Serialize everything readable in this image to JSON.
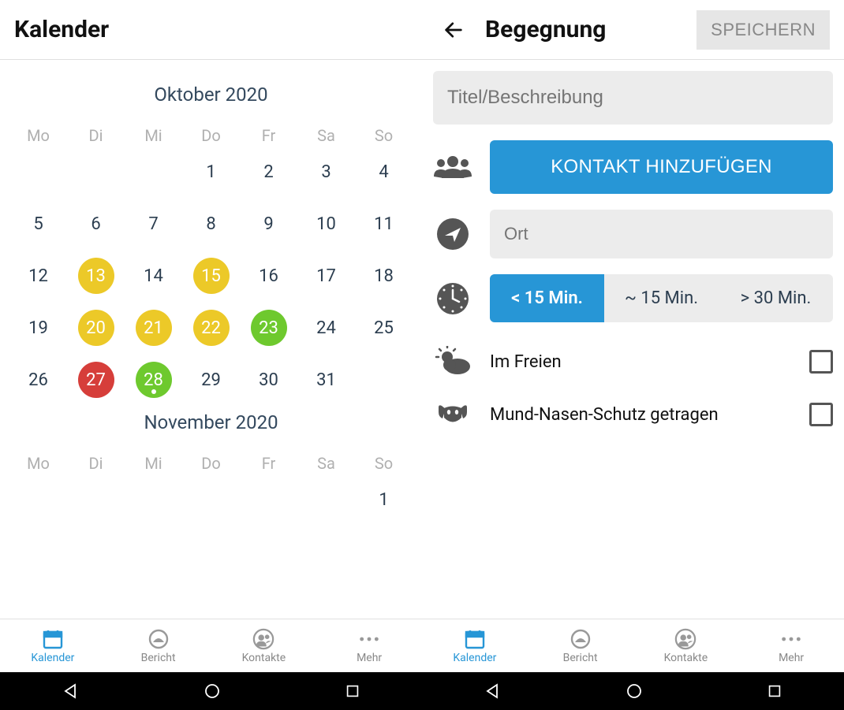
{
  "left": {
    "title": "Kalender",
    "months": [
      {
        "name": "Oktober 2020",
        "weekdays": [
          "Mo",
          "Di",
          "Mi",
          "Do",
          "Fr",
          "Sa",
          "So"
        ],
        "weeks": [
          [
            null,
            null,
            {
              "d": 1
            },
            {
              "d": 2
            },
            {
              "d": 3
            },
            {
              "d": 4
            },
            null
          ],
          [
            null,
            null,
            null,
            {
              "d": 1
            },
            {
              "d": 2
            },
            {
              "d": 3
            },
            {
              "d": 4
            }
          ],
          [
            {
              "d": 5
            },
            {
              "d": 6
            },
            {
              "d": 7
            },
            {
              "d": 8
            },
            {
              "d": 9
            },
            {
              "d": 10
            },
            {
              "d": 11
            }
          ],
          [
            {
              "d": 12
            },
            {
              "d": 13,
              "c": "yellow"
            },
            {
              "d": 14
            },
            {
              "d": 15,
              "c": "yellow"
            },
            {
              "d": 16
            },
            {
              "d": 17
            },
            {
              "d": 18
            }
          ],
          [
            {
              "d": 19
            },
            {
              "d": 20,
              "c": "yellow"
            },
            {
              "d": 21,
              "c": "yellow"
            },
            {
              "d": 22,
              "c": "yellow"
            },
            {
              "d": 23,
              "c": "green"
            },
            {
              "d": 24
            },
            {
              "d": 25
            }
          ],
          [
            {
              "d": 26
            },
            {
              "d": 27,
              "c": "red"
            },
            {
              "d": 28,
              "c": "green",
              "dot": true
            },
            {
              "d": 29
            },
            {
              "d": 30
            },
            {
              "d": 31
            },
            null
          ]
        ]
      },
      {
        "name": "November 2020",
        "weekdays": [
          "Mo",
          "Di",
          "Mi",
          "Do",
          "Fr",
          "Sa",
          "So"
        ],
        "weeks": [
          [
            null,
            null,
            null,
            null,
            null,
            null,
            {
              "d": 1
            }
          ]
        ]
      }
    ]
  },
  "right": {
    "title": "Begegnung",
    "save_label": "SPEICHERN",
    "title_placeholder": "Titel/Beschreibung",
    "add_contact_label": "KONTAKT HINZUFÜGEN",
    "location_placeholder": "Ort",
    "duration_options": [
      "< 15 Min.",
      "~ 15 Min.",
      "> 30 Min."
    ],
    "duration_selected": 0,
    "outdoor_label": "Im Freien",
    "mask_label": "Mund-Nasen-Schutz getragen"
  },
  "nav": {
    "items": [
      {
        "label": "Kalender",
        "icon": "calendar",
        "active": true
      },
      {
        "label": "Bericht",
        "icon": "gauge"
      },
      {
        "label": "Kontakte",
        "icon": "contacts"
      },
      {
        "label": "Mehr",
        "icon": "more"
      }
    ]
  }
}
